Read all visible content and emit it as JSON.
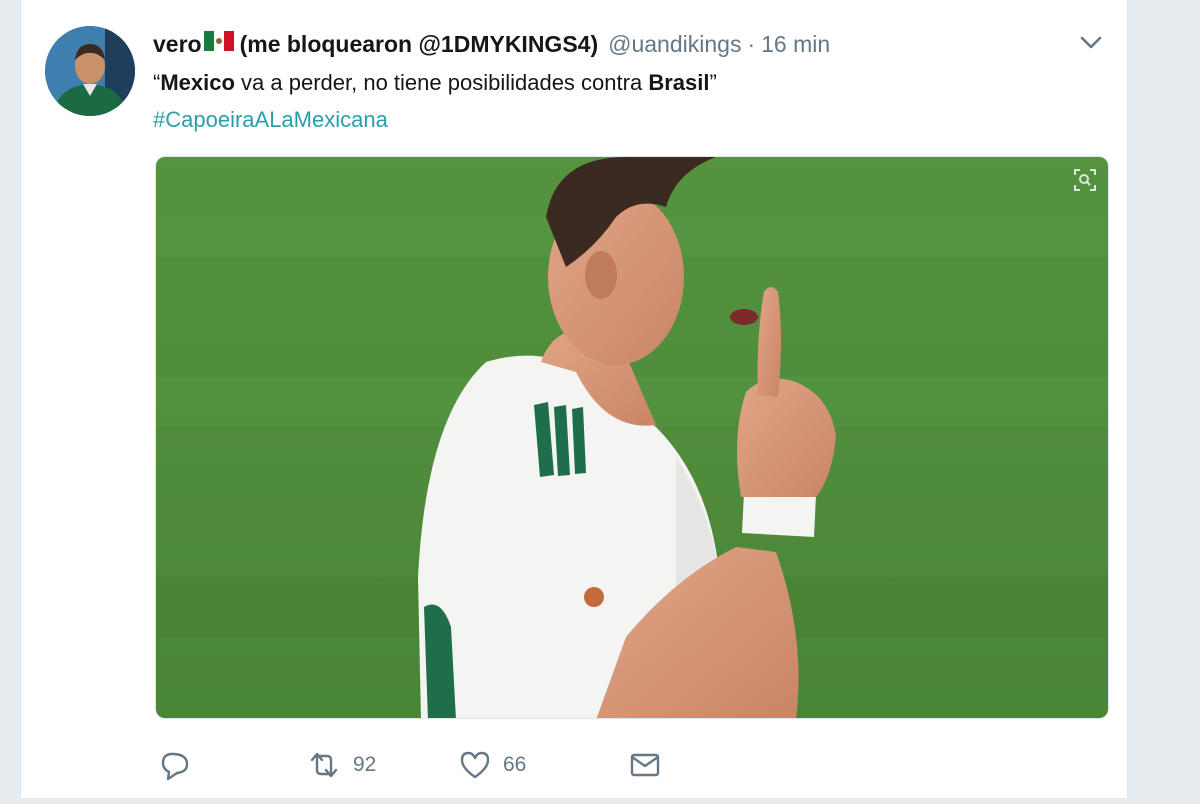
{
  "tweet": {
    "display_name": "vero",
    "name_suffix": "(me bloquearon @1DMYKINGS4)",
    "handle": "@uandikings",
    "separator": "·",
    "time": "16 min",
    "text_open_quote": "“",
    "text_bold_1": "Mexico",
    "text_mid": " va a perder, no tiene posibilidades contra ",
    "text_bold_2": "Brasil",
    "text_close_quote": "”",
    "hashtag": "#CapoeiraALaMexicana"
  },
  "actions": {
    "reply_icon": "reply-icon",
    "retweet_icon": "retweet-icon",
    "retweet_count": "92",
    "like_icon": "heart-icon",
    "like_count": "66",
    "dm_icon": "envelope-icon"
  },
  "colors": {
    "background": "#e6ecf0",
    "card": "#ffffff",
    "text_primary": "#14171a",
    "text_secondary": "#657786",
    "hashtag": "#2a9fa8",
    "pitch_green": "#4f8a3c"
  }
}
